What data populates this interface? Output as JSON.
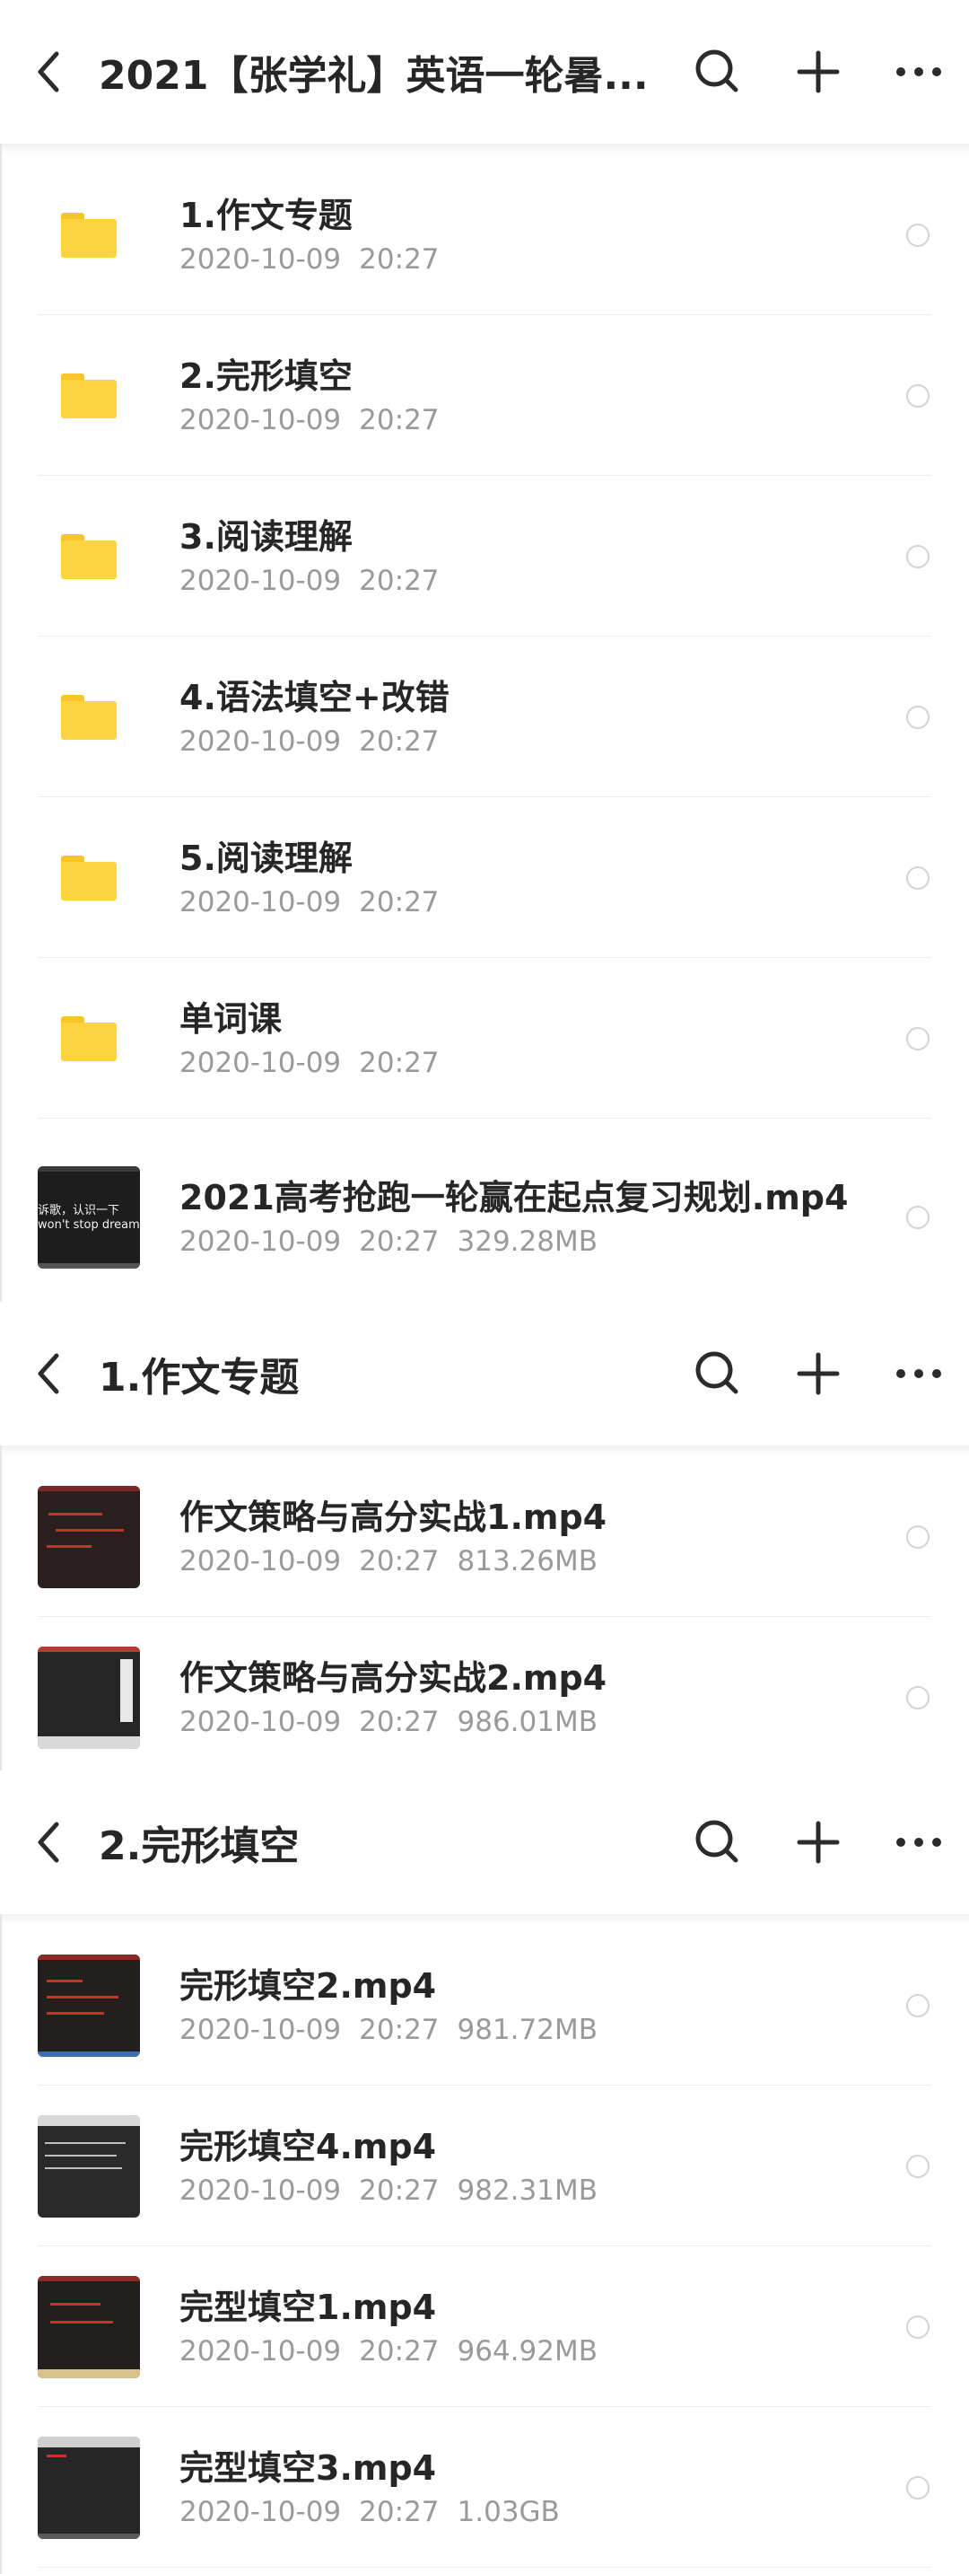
{
  "panels": [
    {
      "title": "2021【张学礼】英语一轮暑...",
      "items": [
        {
          "kind": "folder",
          "name": "1.作文专题",
          "date": "2020-10-09",
          "time": "20:27",
          "size": ""
        },
        {
          "kind": "folder",
          "name": "2.完形填空",
          "date": "2020-10-09",
          "time": "20:27",
          "size": ""
        },
        {
          "kind": "folder",
          "name": "3.阅读理解",
          "date": "2020-10-09",
          "time": "20:27",
          "size": ""
        },
        {
          "kind": "folder",
          "name": "4.语法填空+改错",
          "date": "2020-10-09",
          "time": "20:27",
          "size": ""
        },
        {
          "kind": "folder",
          "name": "5.阅读理解",
          "date": "2020-10-09",
          "time": "20:27",
          "size": ""
        },
        {
          "kind": "folder",
          "name": "单词课",
          "date": "2020-10-09",
          "time": "20:27",
          "size": ""
        },
        {
          "kind": "video",
          "name": "2021高考抢跑一轮赢在起点复习规划.mp4",
          "date": "2020-10-09",
          "time": "20:27",
          "size": "329.28MB",
          "thumb_caption_1": "诉歌，认识一下",
          "thumb_caption_2": "won't stop dreaming"
        }
      ]
    },
    {
      "title": "1.作文专题",
      "items": [
        {
          "kind": "video",
          "name": "作文策略与高分实战1.mp4",
          "date": "2020-10-09",
          "time": "20:27",
          "size": "813.26MB"
        },
        {
          "kind": "video",
          "name": "作文策略与高分实战2.mp4",
          "date": "2020-10-09",
          "time": "20:27",
          "size": "986.01MB"
        }
      ]
    },
    {
      "title": "2.完形填空",
      "items": [
        {
          "kind": "video",
          "name": "完形填空2.mp4",
          "date": "2020-10-09",
          "time": "20:27",
          "size": "981.72MB"
        },
        {
          "kind": "video",
          "name": "完形填空4.mp4",
          "date": "2020-10-09",
          "time": "20:27",
          "size": "982.31MB"
        },
        {
          "kind": "video",
          "name": "完型填空1.mp4",
          "date": "2020-10-09",
          "time": "20:27",
          "size": "964.92MB"
        },
        {
          "kind": "video",
          "name": "完型填空3.mp4",
          "date": "2020-10-09",
          "time": "20:27",
          "size": "1.03GB"
        }
      ]
    }
  ],
  "icons": {
    "back": "chevron-left-icon",
    "search": "search-icon",
    "add": "plus-icon",
    "more": "more-horizontal-icon",
    "folder": "folder-icon"
  },
  "colors": {
    "folder": "#fcd440",
    "text_primary": "#262626",
    "text_secondary": "#9a9a9a"
  }
}
